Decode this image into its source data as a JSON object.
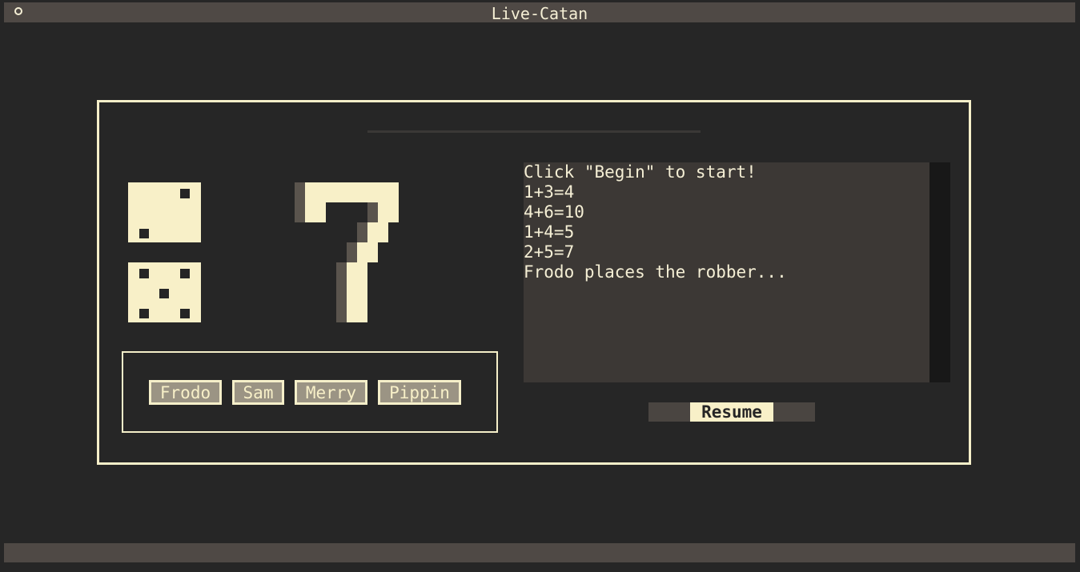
{
  "window": {
    "title": "Live-Catan",
    "control_icon": "circle-icon"
  },
  "dice": {
    "die1": 2,
    "die2": 5,
    "total": 7
  },
  "players": [
    "Frodo",
    "Sam",
    "Merry",
    "Pippin"
  ],
  "log": {
    "lines": [
      "Click \"Begin\" to start!",
      "1+3=4",
      "4+6=10",
      "1+4=5",
      "2+5=7",
      "Frodo places the robber..."
    ]
  },
  "controls": {
    "resume_label": "Resume"
  },
  "colors": {
    "background": "#262626",
    "bar": "#4f4945",
    "cream": "#f8f0c8",
    "button_fill": "#9b9484",
    "log_bg": "#3c3835"
  }
}
